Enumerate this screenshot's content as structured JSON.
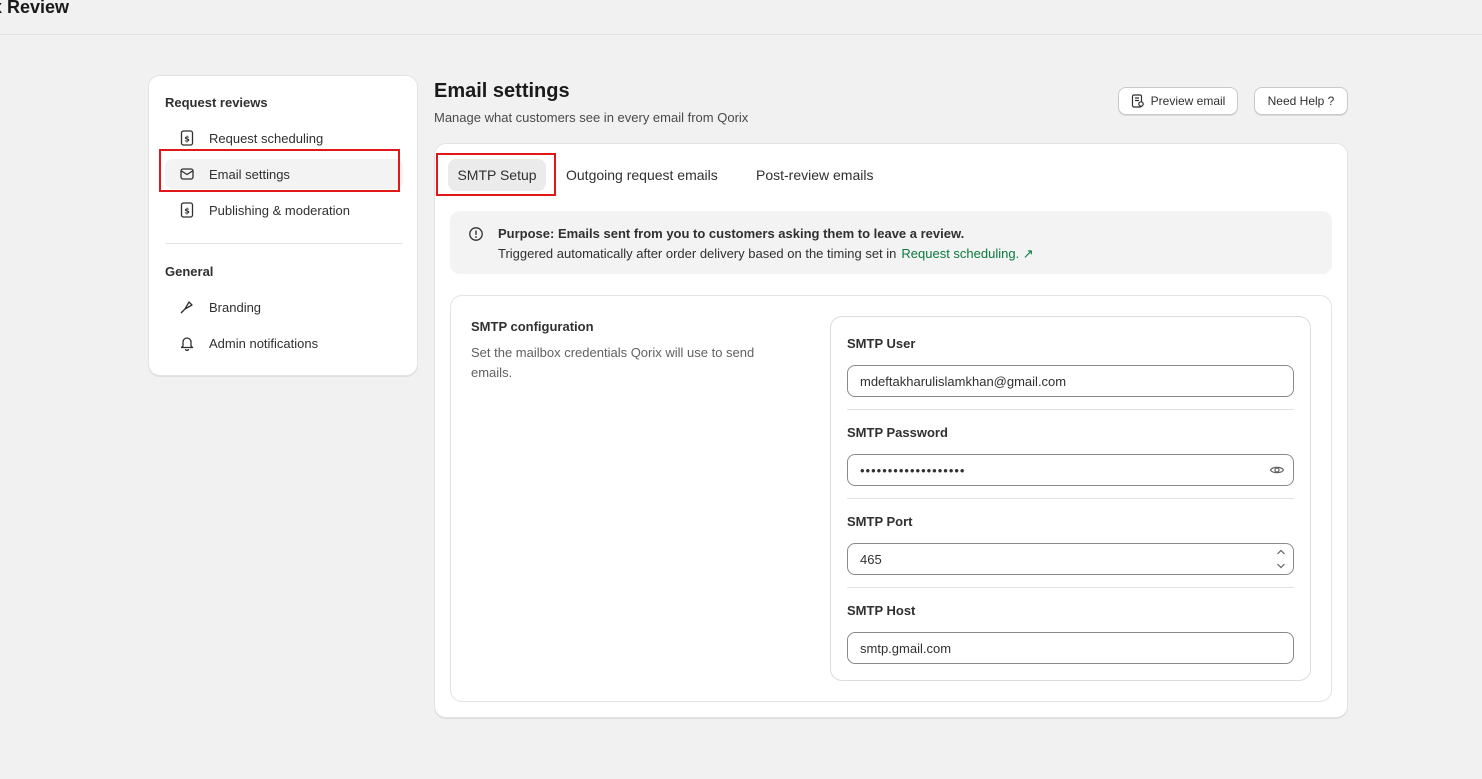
{
  "app": {
    "title": "x Review"
  },
  "sidebar": {
    "section1_heading": "Request reviews",
    "items": [
      {
        "label": "Request scheduling",
        "icon": "receipt-icon"
      },
      {
        "label": "Email settings",
        "icon": "email-icon"
      },
      {
        "label": "Publishing & moderation",
        "icon": "receipt-icon"
      }
    ],
    "section2_heading": "General",
    "general_items": [
      {
        "label": "Branding",
        "icon": "paint-brush-icon"
      },
      {
        "label": "Admin notifications",
        "icon": "bell-icon"
      }
    ]
  },
  "header": {
    "title": "Email settings",
    "subtitle": "Manage what customers see in every email from Qorix",
    "preview_button": "Preview email",
    "help_button": "Need Help ?"
  },
  "tabs": [
    {
      "label": "SMTP Setup",
      "active": true
    },
    {
      "label": "Outgoing request emails",
      "active": false
    },
    {
      "label": "Post-review emails",
      "active": false
    }
  ],
  "banner": {
    "line1": "Purpose: Emails sent from you to customers asking them to leave a review.",
    "line2": "Triggered automatically after order delivery based on the timing set in",
    "link": "Request scheduling. ↗"
  },
  "smtp": {
    "title": "SMTP configuration",
    "description": "Set the mailbox credentials Qorix will use to send emails.",
    "user_label": "SMTP User",
    "user_value": "mdeftakharulislamkhan@gmail.com",
    "password_label": "SMTP Password",
    "password_value": "•••••••••••••••••••",
    "port_label": "SMTP Port",
    "port_value": "465",
    "host_label": "SMTP Host",
    "host_value": "smtp.gmail.com"
  }
}
